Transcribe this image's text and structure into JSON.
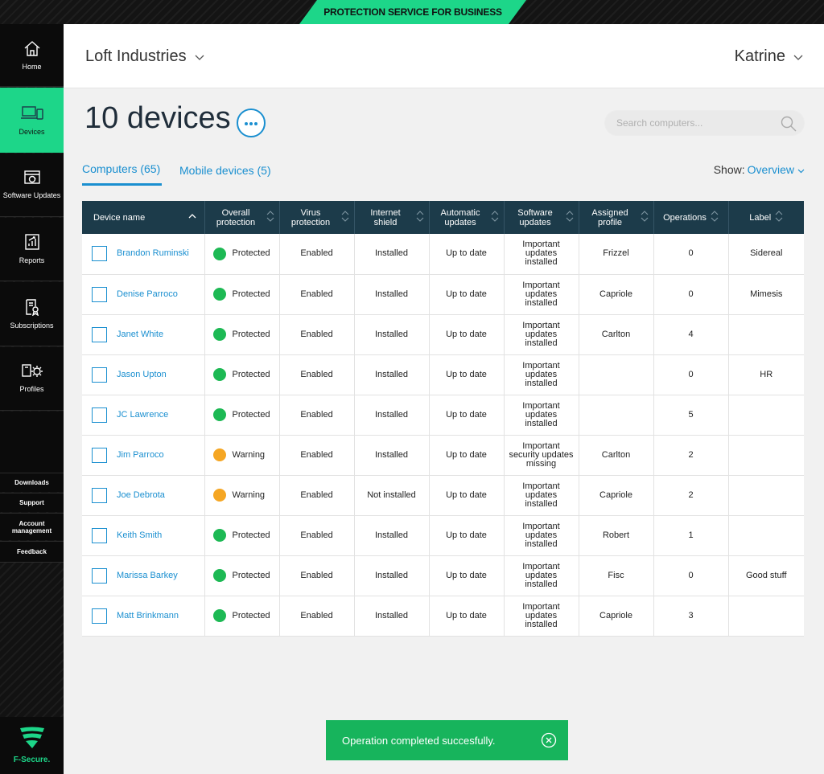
{
  "banner": {
    "title": "PROTECTION SERVICE FOR BUSINESS"
  },
  "sidebar": {
    "items": [
      {
        "label": "Home",
        "icon": "home-icon"
      },
      {
        "label": "Devices",
        "icon": "devices-icon",
        "active": true
      },
      {
        "label": "Software Updates",
        "icon": "software-updates-icon"
      },
      {
        "label": "Reports",
        "icon": "reports-icon"
      },
      {
        "label": "Subscriptions",
        "icon": "subscriptions-icon"
      },
      {
        "label": "Profiles",
        "icon": "profiles-icon"
      }
    ],
    "links": [
      "Downloads",
      "Support",
      "Account management",
      "Feedback"
    ],
    "logo_text": "F-Secure."
  },
  "header": {
    "organization": "Loft Industries",
    "user": "Katrine"
  },
  "page": {
    "title": "10 devices",
    "search_placeholder": "Search computers..."
  },
  "tabs": [
    {
      "label": "Computers (65)",
      "active": true
    },
    {
      "label": "Mobile devices (5)",
      "active": false
    }
  ],
  "show": {
    "label": "Show:",
    "value": "Overview"
  },
  "table": {
    "columns": [
      "Device name",
      "Overall protection",
      "Virus protection",
      "Internet shield",
      "Automatic updates",
      "Software updates",
      "Assigned profile",
      "Operations",
      "Label"
    ],
    "rows": [
      {
        "name": "Brandon Ruminski",
        "status": "Protected",
        "virus": "Enabled",
        "shield": "Installed",
        "auto": "Up to date",
        "software": "Important updates installed",
        "profile": "Frizzel",
        "ops": "0",
        "label": "Sidereal"
      },
      {
        "name": "Denise Parroco",
        "status": "Protected",
        "virus": "Enabled",
        "shield": "Installed",
        "auto": "Up to date",
        "software": "Important updates installed",
        "profile": "Capriole",
        "ops": "0",
        "label": "Mimesis"
      },
      {
        "name": "Janet White",
        "status": "Protected",
        "virus": "Enabled",
        "shield": "Installed",
        "auto": "Up to date",
        "software": "Important updates installed",
        "profile": "Carlton",
        "ops": "4",
        "label": ""
      },
      {
        "name": "Jason Upton",
        "status": "Protected",
        "virus": "Enabled",
        "shield": "Installed",
        "auto": "Up to date",
        "software": "Important updates installed",
        "profile": "",
        "ops": "0",
        "label": "HR"
      },
      {
        "name": "JC Lawrence",
        "status": "Protected",
        "virus": "Enabled",
        "shield": "Installed",
        "auto": "Up to date",
        "software": "Important updates installed",
        "profile": "",
        "ops": "5",
        "label": ""
      },
      {
        "name": "Jim Parroco",
        "status": "Warning",
        "virus": "Enabled",
        "shield": "Installed",
        "auto": "Up to date",
        "software": "Important security updates missing",
        "profile": "Carlton",
        "ops": "2",
        "label": ""
      },
      {
        "name": "Joe Debrota",
        "status": "Warning",
        "virus": "Enabled",
        "shield": "Not installed",
        "auto": "Up to date",
        "software": "Important updates installed",
        "profile": "Capriole",
        "ops": "2",
        "label": ""
      },
      {
        "name": "Keith Smith",
        "status": "Protected",
        "virus": "Enabled",
        "shield": "Installed",
        "auto": "Up to date",
        "software": "Important updates installed",
        "profile": "Robert",
        "ops": "1",
        "label": ""
      },
      {
        "name": "Marissa Barkey",
        "status": "Protected",
        "virus": "Enabled",
        "shield": "Installed",
        "auto": "Up to date",
        "software": "Important updates installed",
        "profile": "Fisc",
        "ops": "0",
        "label": "Good stuff"
      },
      {
        "name": "Matt Brinkmann",
        "status": "Protected",
        "virus": "Enabled",
        "shield": "Installed",
        "auto": "Up to date",
        "software": "Important updates installed",
        "profile": "Capriole",
        "ops": "3",
        "label": ""
      }
    ]
  },
  "status_colors": {
    "Protected": "#1db954",
    "Warning": "#f5a623"
  },
  "colors": {
    "accent": "#1dd689",
    "link": "#1a8fd0",
    "table_header": "#1c3b4a",
    "toast": "#17b45c"
  },
  "toast": {
    "message": "Operation completed succesfully."
  }
}
